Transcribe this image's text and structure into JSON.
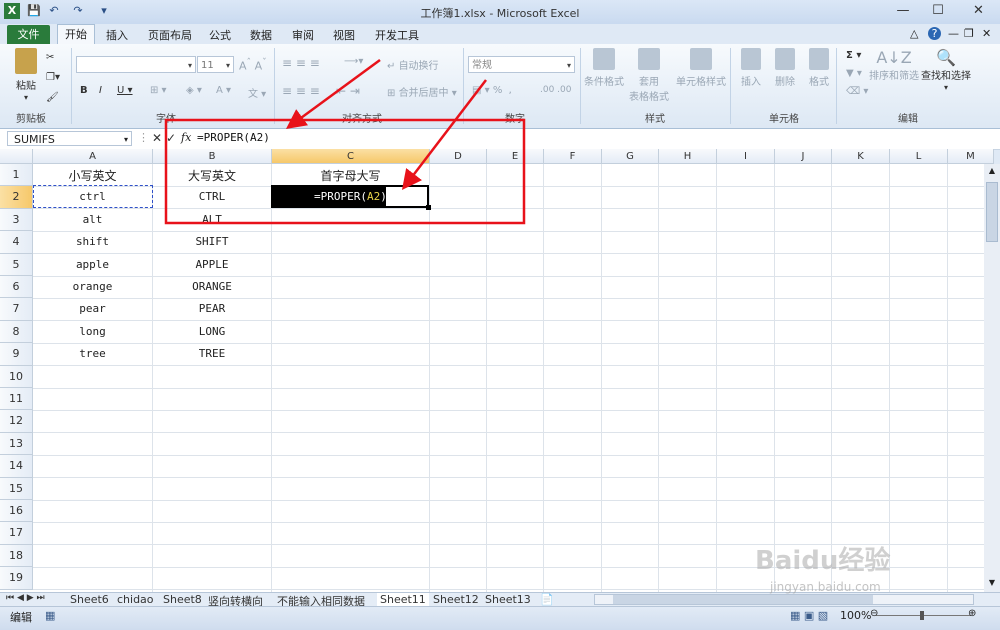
{
  "window": {
    "title": "工作簿1.xlsx - Microsoft Excel"
  },
  "tabs": [
    "文件",
    "开始",
    "插入",
    "页面布局",
    "公式",
    "数据",
    "审阅",
    "视图",
    "开发工具"
  ],
  "ribbon": {
    "paste": "粘贴",
    "clipboard": "剪贴板",
    "font_group": "字体",
    "font_size": "11",
    "align_group": "对齐方式",
    "wrap": "自动换行",
    "merge": "合并后居中",
    "number_group": "数字",
    "number_format": "常规",
    "styles_group": "样式",
    "cond_format": "条件格式",
    "table_format_1": "套用",
    "table_format_2": "表格格式",
    "cell_style": "单元格样式",
    "cells_group": "单元格",
    "insert": "插入",
    "delete": "删除",
    "format": "格式",
    "editing_group": "编辑",
    "sort": "排序和筛选",
    "find": "查找和选择"
  },
  "formula_bar": {
    "name_box": "SUMIFS",
    "fx": "fx",
    "formula": "=PROPER(A2)"
  },
  "columns": [
    "A",
    "B",
    "C",
    "D",
    "E",
    "F",
    "G",
    "H",
    "I",
    "J",
    "K",
    "L",
    "M"
  ],
  "rows": [
    "1",
    "2",
    "3",
    "4",
    "5",
    "6",
    "7",
    "8",
    "9",
    "10",
    "11",
    "12",
    "13",
    "14",
    "15",
    "16",
    "17",
    "18",
    "19"
  ],
  "cells": {
    "A": [
      "小写英文",
      "ctrl",
      "alt",
      "shift",
      "apple",
      "orange",
      "pear",
      "long",
      "tree"
    ],
    "B": [
      "大写英文",
      "CTRL",
      "ALT",
      "SHIFT",
      "APPLE",
      "ORANGE",
      "PEAR",
      "LONG",
      "TREE"
    ],
    "C1": "首字母大写",
    "C2_prefix": "=PROPER(",
    "C2_ref": "A2",
    "C2_suffix": ")"
  },
  "sheets": [
    "Sheet6",
    "chidao",
    "Sheet8",
    "竖向转横向",
    "不能输入相同数据",
    "Sheet11",
    "Sheet12",
    "Sheet13"
  ],
  "status": {
    "mode": "编辑",
    "zoom": "100%"
  },
  "watermark": {
    "brand": "Baidu经验",
    "url": "jingyan.baidu.com"
  },
  "colors": {
    "file_tab": "#2a7b3b",
    "annotation": "#e8121a",
    "active_col": "#f6c86a"
  }
}
